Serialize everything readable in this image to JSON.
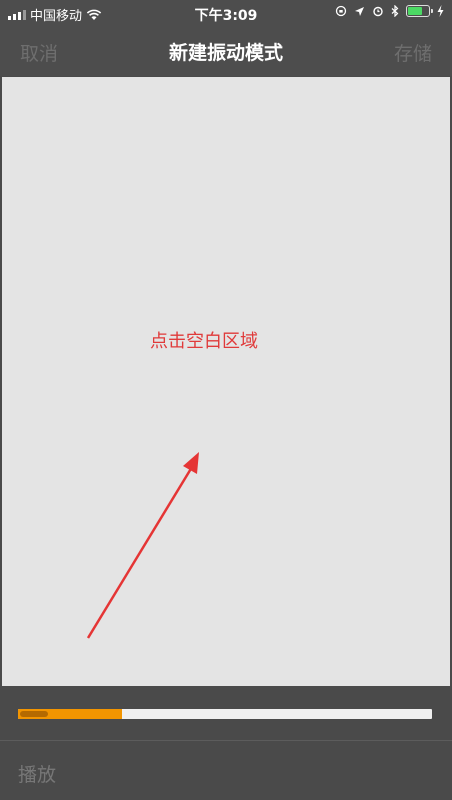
{
  "status": {
    "carrier": "中国移动",
    "time": "下午3:09"
  },
  "nav": {
    "cancel": "取消",
    "title": "新建振动模式",
    "save": "存储"
  },
  "canvas": {
    "hint": "点击空白区域"
  },
  "playback": {
    "progress": 0.25,
    "play_label": "播放"
  },
  "colors": {
    "accent": "#f39500",
    "hint": "#e03a3a"
  }
}
